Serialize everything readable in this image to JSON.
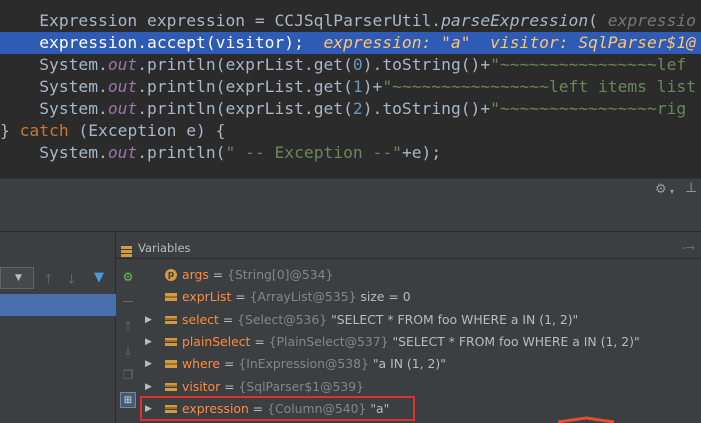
{
  "editor": {
    "lines": [
      [
        {
          "t": "    Expression expression = CCJSqlParserUtil.",
          "c": "plain"
        },
        {
          "t": "parseExpression",
          "c": "ital"
        },
        {
          "t": "( ",
          "c": "plain"
        },
        {
          "t": "expressio",
          "c": "hint"
        }
      ],
      [
        {
          "t": "    expression.accept(visitor);  ",
          "c": "plain"
        },
        {
          "t": "expression: \"a\"  visitor: SqlParser$1@",
          "c": "inl"
        }
      ],
      [
        {
          "t": "    System.",
          "c": "plain"
        },
        {
          "t": "out",
          "c": "static-field"
        },
        {
          "t": ".println(exprList.get(",
          "c": "plain"
        },
        {
          "t": "0",
          "c": "num"
        },
        {
          "t": ").toString()+",
          "c": "plain"
        },
        {
          "t": "\"~~~~~~~~~~~~~~~~lef",
          "c": "str"
        }
      ],
      [
        {
          "t": "    System.",
          "c": "plain"
        },
        {
          "t": "out",
          "c": "static-field"
        },
        {
          "t": ".println(exprList.get(",
          "c": "plain"
        },
        {
          "t": "1",
          "c": "num"
        },
        {
          "t": ")+",
          "c": "plain"
        },
        {
          "t": "\"~~~~~~~~~~~~~~~~left items list",
          "c": "str"
        }
      ],
      [
        {
          "t": "    System.",
          "c": "plain"
        },
        {
          "t": "out",
          "c": "static-field"
        },
        {
          "t": ".println(exprList.get(",
          "c": "plain"
        },
        {
          "t": "2",
          "c": "num"
        },
        {
          "t": ").toString()+",
          "c": "plain"
        },
        {
          "t": "\"~~~~~~~~~~~~~~~~rig",
          "c": "str"
        }
      ],
      [
        {
          "t": "} ",
          "c": "plain"
        },
        {
          "t": "catch",
          "c": "kw"
        },
        {
          "t": " (Exception e) {",
          "c": "plain"
        }
      ],
      [
        {
          "t": "    System.",
          "c": "plain"
        },
        {
          "t": "out",
          "c": "static-field"
        },
        {
          "t": ".println(",
          "c": "plain"
        },
        {
          "t": "\" -- Exception --\"",
          "c": "str"
        },
        {
          "t": "+e);",
          "c": "plain"
        }
      ]
    ],
    "exec_line_index": 1
  },
  "debugger": {
    "variables_title": "Variables",
    "variables": [
      {
        "expandable": false,
        "icon": "param",
        "name": "args",
        "eq": " = ",
        "type": "{String[0]@534}",
        "value": ""
      },
      {
        "expandable": false,
        "icon": "field",
        "name": "exprList",
        "eq": " = ",
        "type": "{ArrayList@535}",
        "value": "  size = 0"
      },
      {
        "expandable": true,
        "icon": "field",
        "name": "select",
        "eq": " = ",
        "type": "{Select@536}",
        "value": " \"SELECT * FROM foo WHERE a IN (1, 2)\""
      },
      {
        "expandable": true,
        "icon": "field",
        "name": "plainSelect",
        "eq": " = ",
        "type": "{PlainSelect@537}",
        "value": " \"SELECT * FROM foo WHERE a IN (1, 2)\""
      },
      {
        "expandable": true,
        "icon": "field",
        "name": "where",
        "eq": " = ",
        "type": "{InExpression@538}",
        "value": " \"a IN (1, 2)\""
      },
      {
        "expandable": true,
        "icon": "field",
        "name": "visitor",
        "eq": " = ",
        "type": "{SqlParser$1@539}",
        "value": ""
      },
      {
        "expandable": true,
        "icon": "field",
        "name": "expression",
        "eq": " = ",
        "type": "{Column@540}",
        "value": " \"a\""
      }
    ],
    "highlighted_variable": "expression"
  },
  "icons": {
    "settings": "gear-icon",
    "hide": "minimize-icon",
    "up": "arrow-up-icon",
    "down": "arrow-down-icon",
    "filter": "filter-icon",
    "pin": "pin-icon"
  },
  "colors": {
    "editor_bg": "#2b2b2b",
    "exec_line": "#2d5bb5",
    "panel_bg": "#3c3f41",
    "var_name": "#ff8b3d",
    "highlight_box": "#e0302a"
  }
}
